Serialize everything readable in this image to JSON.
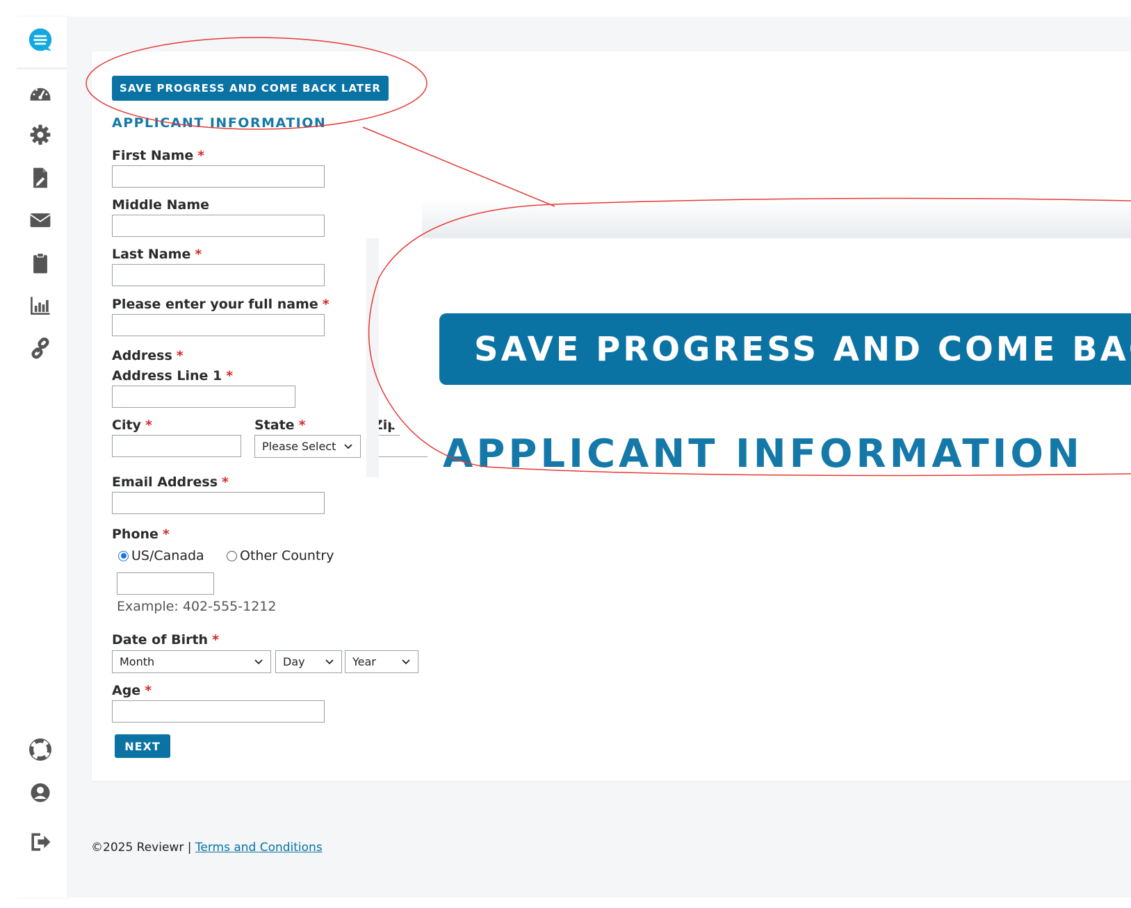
{
  "sidebar": {
    "items": [
      {
        "icon": "dashboard-gauge-icon"
      },
      {
        "icon": "gear-icon"
      },
      {
        "icon": "document-edit-icon"
      },
      {
        "icon": "envelope-icon"
      },
      {
        "icon": "clipboard-icon"
      },
      {
        "icon": "bar-chart-icon"
      },
      {
        "icon": "link-icon"
      }
    ],
    "bottom_items": [
      {
        "icon": "lifebuoy-icon"
      },
      {
        "icon": "user-circle-icon"
      },
      {
        "icon": "sign-out-icon"
      }
    ]
  },
  "form": {
    "save_button": "SAVE PROGRESS AND COME BACK LATER",
    "section_title": "APPLICANT INFORMATION",
    "first_name_label": "First Name",
    "middle_name_label": "Middle Name",
    "last_name_label": "Last Name",
    "full_name_label": "Please enter your full name",
    "address_label": "Address",
    "address_line1_label": "Address Line 1",
    "city_label": "City",
    "state_label": "State",
    "state_value": "Please Select",
    "zip_label": "Zip C",
    "email_label": "Email Address",
    "phone_label": "Phone",
    "phone_option_us": "US/Canada",
    "phone_option_other": "Other Country",
    "phone_example": "Example: 402-555-1212",
    "dob_label": "Date of Birth",
    "dob_month": "Month",
    "dob_day": "Day",
    "dob_year": "Year",
    "age_label": "Age",
    "required_mark": "*",
    "next_button": "NEXT"
  },
  "zoom": {
    "button_text": "SAVE PROGRESS AND COME BACK",
    "title_text": "APPLICANT INFORMATION"
  },
  "footer": {
    "copyright": "©2025 Reviewr | ",
    "terms_link": "Terms and Conditions"
  },
  "colors": {
    "brand": "#0a73a4",
    "required": "#d12b2b",
    "annotation": "#e53935"
  }
}
